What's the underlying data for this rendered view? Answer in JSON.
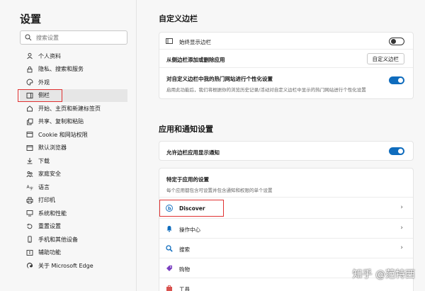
{
  "sidebar": {
    "title": "设置",
    "search_placeholder": "搜索设置",
    "items": [
      {
        "label": "个人资料",
        "icon": "user-icon"
      },
      {
        "label": "隐私、搜索和服务",
        "icon": "lock-icon"
      },
      {
        "label": "外观",
        "icon": "palette-icon"
      },
      {
        "label": "侧栏",
        "icon": "sidebar-icon",
        "active": true
      },
      {
        "label": "开始、主页和新建标签页",
        "icon": "home-icon"
      },
      {
        "label": "共享、复制和粘贴",
        "icon": "share-icon"
      },
      {
        "label": "Cookie 和网站权限",
        "icon": "site-permissions-icon"
      },
      {
        "label": "默认浏览器",
        "icon": "browser-icon"
      },
      {
        "label": "下载",
        "icon": "download-icon"
      },
      {
        "label": "家庭安全",
        "icon": "family-icon"
      },
      {
        "label": "语言",
        "icon": "language-icon"
      },
      {
        "label": "打印机",
        "icon": "printer-icon"
      },
      {
        "label": "系统和性能",
        "icon": "system-icon"
      },
      {
        "label": "重置设置",
        "icon": "reset-icon"
      },
      {
        "label": "手机和其他设备",
        "icon": "phone-icon"
      },
      {
        "label": "辅助功能",
        "icon": "accessibility-icon"
      },
      {
        "label": "关于 Microsoft Edge",
        "icon": "edge-icon"
      }
    ]
  },
  "section1": {
    "title": "自定义边栏",
    "always_show_label": "始终显示边栏",
    "always_show_on": false,
    "add_remove_label": "从侧边栏添加或删除应用",
    "customize_button": "自定义边栏",
    "personalize_label": "对自定义边栏中我的热门网站进行个性化设置",
    "personalize_desc": "启用此功能后，我们将根据你的浏览历史记录/活动对自定义边栏中显示的热门网站进行个性化设置",
    "personalize_on": true
  },
  "section2": {
    "title": "应用和通知设置",
    "allow_notify_label": "允许边栏应用显示通知",
    "allow_notify_on": true,
    "specific_title": "特定于应用的设置",
    "specific_desc": "每个应用都包含可设置并包含通知和权限的单个设置",
    "apps": [
      {
        "label": "Discover",
        "icon": "discover-icon"
      },
      {
        "label": "操作中心",
        "icon": "bell-icon"
      },
      {
        "label": "搜索",
        "icon": "search-icon"
      },
      {
        "label": "购物",
        "icon": "shopping-tag-icon"
      },
      {
        "label": "工具",
        "icon": "toolbox-icon"
      }
    ]
  },
  "watermark": "知乎 @范特西",
  "colors": {
    "accent": "#0f6cbd",
    "highlight": "#e03131"
  }
}
